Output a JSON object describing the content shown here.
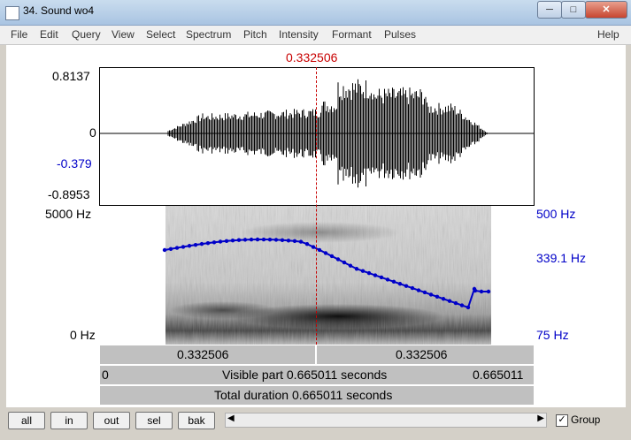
{
  "window": {
    "title": "34. Sound wo4",
    "minimize": "─",
    "maximize": "□",
    "close": "✕"
  },
  "menu": [
    "File",
    "Edit",
    "Query",
    "View",
    "Select",
    "Spectrum",
    "Pitch",
    "Intensity",
    "Formant",
    "Pulses"
  ],
  "menu_help": "Help",
  "cursor_time": "0.332506",
  "waveform": {
    "max": "0.8137",
    "zero": "0",
    "sel_value": "-0.379",
    "min": "-0.8953"
  },
  "spectrogram": {
    "freq_max": "5000 Hz",
    "freq_min": "0 Hz"
  },
  "pitch": {
    "max": "500 Hz",
    "value": "339.1 Hz",
    "min": "75 Hz"
  },
  "time_bar": {
    "left": "0.332506",
    "right": "0.332506"
  },
  "visible_bar": {
    "start": "0",
    "text": "Visible part 0.665011 seconds",
    "end": "0.665011"
  },
  "total_bar": {
    "text": "Total duration 0.665011 seconds"
  },
  "buttons": {
    "all": "all",
    "in": "in",
    "out": "out",
    "sel": "sel",
    "bak": "bak"
  },
  "group": {
    "label": "Group",
    "checked": "✓"
  },
  "scroll": {
    "left": "◀",
    "right": "▶"
  },
  "colors": {
    "pitch": "#0000c8",
    "cursor": "#c80000"
  }
}
